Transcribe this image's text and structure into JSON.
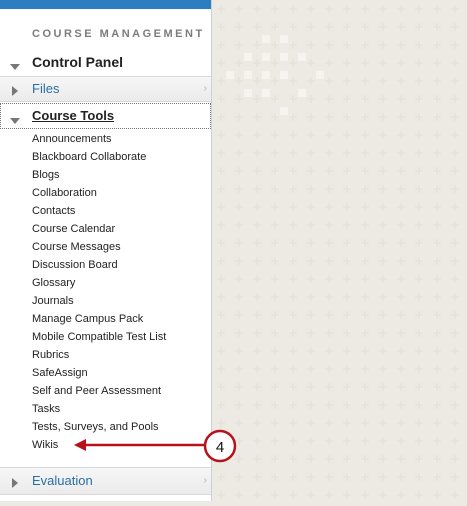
{
  "header": {
    "section_title": "COURSE MANAGEMENT"
  },
  "control_panel": {
    "label": "Control Panel"
  },
  "files": {
    "label": "Files"
  },
  "course_tools": {
    "label": "Course Tools",
    "items": [
      "Announcements",
      "Blackboard Collaborate",
      "Blogs",
      "Collaboration",
      "Contacts",
      "Course Calendar",
      "Course Messages",
      "Discussion Board",
      "Glossary",
      "Journals",
      "Manage Campus Pack",
      "Mobile Compatible Test List",
      "Rubrics",
      "SafeAssign",
      "Self and Peer Assessment",
      "Tasks",
      "Tests, Surveys, and Pools",
      "Wikis"
    ]
  },
  "evaluation": {
    "label": "Evaluation"
  },
  "callout": {
    "number": "4"
  },
  "colors": {
    "accent": "#2b7fc1",
    "arrow": "#b5121b",
    "link": "#2a6fa3"
  },
  "icons": [
    "triangle-down-icon",
    "triangle-right-icon",
    "chevron-right-icon"
  ]
}
